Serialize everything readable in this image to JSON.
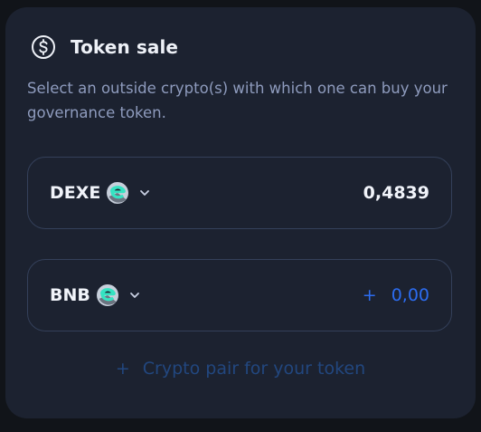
{
  "card": {
    "title": "Token sale",
    "subtitle": "Select an outside crypto(s) with which one can buy your governance token."
  },
  "tokens": [
    {
      "symbol": "DEXE",
      "icon": "dexe-token-icon",
      "amount": "0,4839"
    },
    {
      "symbol": "BNB",
      "icon": "dexe-token-icon",
      "amount_prefix": "+",
      "amount": "0,00"
    }
  ],
  "add_pair": {
    "plus": "+",
    "label": "Crypto pair for your token"
  },
  "colors": {
    "background": "#111419",
    "card": "#1c2230",
    "border": "#34405a",
    "accent": "#2c6cf0",
    "muted_accent": "#22477f",
    "token_teal": "#35e3c2"
  }
}
